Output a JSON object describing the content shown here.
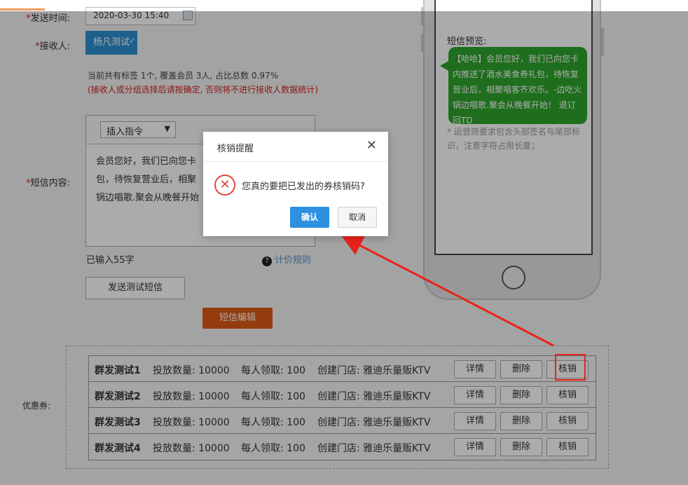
{
  "form": {
    "send_time_label": "发送时间:",
    "send_time_value": "2020-03-30 15:40",
    "receiver_label": "接收人:",
    "receiver_tag": "杨凡测试",
    "receiver_info": "当前共有标签 1个,  覆盖会员 3人,  占比总数 0.97%",
    "receiver_warning": "(接收人或分组选择后请按确定, 否则将不进行接收人数据统计)",
    "content_label": "短信内容:",
    "insert_command": "插入指令",
    "content_lines": [
      "会员您好，我们已向您卡",
      "包，待恢复营业后，相聚",
      "锅边唱歌.聚会从晚餐开始"
    ],
    "char_count": "已输入55字",
    "pricing_rule": "计价规则",
    "send_test_button": "发送测试短信",
    "edit_sms_button": "短信编辑",
    "coupon_label": "优惠券:"
  },
  "coupons": {
    "headers": {
      "qty_label": "投放数量:",
      "per_person_label": "每人领取:",
      "store_label": "创建门店:"
    },
    "rows": [
      {
        "name": "群发测试1",
        "qty": "10000",
        "per_person": "100",
        "store": "雅迪乐量贩KTV",
        "detail": "详情",
        "delete": "删除",
        "redeem": "核销"
      },
      {
        "name": "群发测试2",
        "qty": "10000",
        "per_person": "100",
        "store": "雅迪乐量贩KTV",
        "detail": "详情",
        "delete": "删除",
        "redeem": "核销"
      },
      {
        "name": "群发测试3",
        "qty": "10000",
        "per_person": "100",
        "store": "雅迪乐量贩KTV",
        "detail": "详情",
        "delete": "删除",
        "redeem": "核销"
      },
      {
        "name": "群发测试4",
        "qty": "10000",
        "per_person": "100",
        "store": "雅迪乐量贩KTV",
        "detail": "详情",
        "delete": "删除",
        "redeem": "核销"
      }
    ]
  },
  "preview": {
    "title": "短信预览:",
    "bubble_text": "【哈哈】会员您好，我们已向您卡内推送了酒水美食券礼包，待恢复营业后，相聚唱客齐欢乐。-边吃火锅边唱歌.聚会从晚餐开始！ 退订回TD",
    "hint": "* 运营商要求包含头部签名与尾部标识，注意字符占用长度；"
  },
  "dialog": {
    "title": "核销提醒",
    "message": "您真的要把已发出的券核销码?",
    "confirm": "确认",
    "cancel": "取消",
    "close_symbol": "✕",
    "error_symbol": "✕"
  },
  "colors": {
    "accent_blue": "#2e90e0",
    "orange": "#dd5a14",
    "sms_green": "#2ea52c",
    "highlight_red": "#e8231a"
  }
}
